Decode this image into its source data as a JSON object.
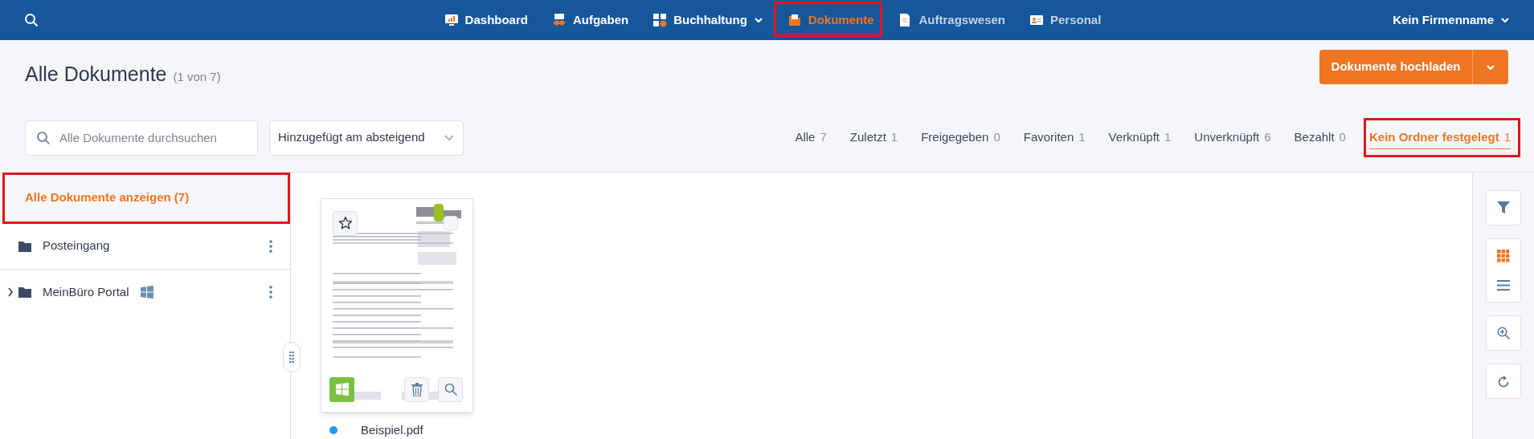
{
  "nav": {
    "items": [
      {
        "label": "Dashboard",
        "selected": false,
        "disabled": false,
        "dropdown": false,
        "highlighted": false
      },
      {
        "label": "Aufgaben",
        "selected": false,
        "disabled": false,
        "dropdown": false,
        "highlighted": false
      },
      {
        "label": "Buchhaltung",
        "selected": false,
        "disabled": false,
        "dropdown": true,
        "highlighted": false
      },
      {
        "label": "Dokumente",
        "selected": true,
        "disabled": false,
        "dropdown": false,
        "highlighted": true
      },
      {
        "label": "Auftragswesen",
        "selected": false,
        "disabled": true,
        "dropdown": false,
        "highlighted": false
      },
      {
        "label": "Personal",
        "selected": false,
        "disabled": true,
        "dropdown": false,
        "highlighted": false
      }
    ],
    "account": "Kein Firmenname"
  },
  "header": {
    "title": "Alle Dokumente",
    "count": "(1 von 7)",
    "upload_button": "Dokumente hochladen"
  },
  "search": {
    "placeholder": "Alle Dokumente durchsuchen"
  },
  "sort": {
    "value": "Hinzugefügt am absteigend"
  },
  "filters": [
    {
      "label": "Alle",
      "count": "7",
      "selected": false,
      "highlighted": false
    },
    {
      "label": "Zuletzt",
      "count": "1",
      "selected": false,
      "highlighted": false
    },
    {
      "label": "Freigegeben",
      "count": "0",
      "selected": false,
      "highlighted": false
    },
    {
      "label": "Favoriten",
      "count": "1",
      "selected": false,
      "highlighted": false
    },
    {
      "label": "Verknüpft",
      "count": "1",
      "selected": false,
      "highlighted": false
    },
    {
      "label": "Unverknüpft",
      "count": "6",
      "selected": false,
      "highlighted": false
    },
    {
      "label": "Bezahlt",
      "count": "0",
      "selected": false,
      "highlighted": false
    },
    {
      "label": "Kein Ordner festgelegt",
      "count": "1",
      "selected": true,
      "highlighted": true
    }
  ],
  "sidebar": {
    "items": [
      {
        "kind": "all",
        "label": "Alle Dokumente anzeigen (7)",
        "selected": true,
        "highlighted": true
      },
      {
        "kind": "folder",
        "label": "Posteingang",
        "selected": false,
        "highlighted": false,
        "expandable": false,
        "portal": false
      },
      {
        "kind": "folder",
        "label": "MeinBüro Portal",
        "selected": false,
        "highlighted": false,
        "expandable": true,
        "portal": true
      }
    ]
  },
  "documents": [
    {
      "name": "Beispiel.pdf",
      "color": "#2196f3",
      "favorite": false,
      "portal": true,
      "selected": false
    }
  ],
  "views": [
    {
      "kind": "grid",
      "selected": true
    },
    {
      "kind": "list",
      "selected": false
    }
  ]
}
